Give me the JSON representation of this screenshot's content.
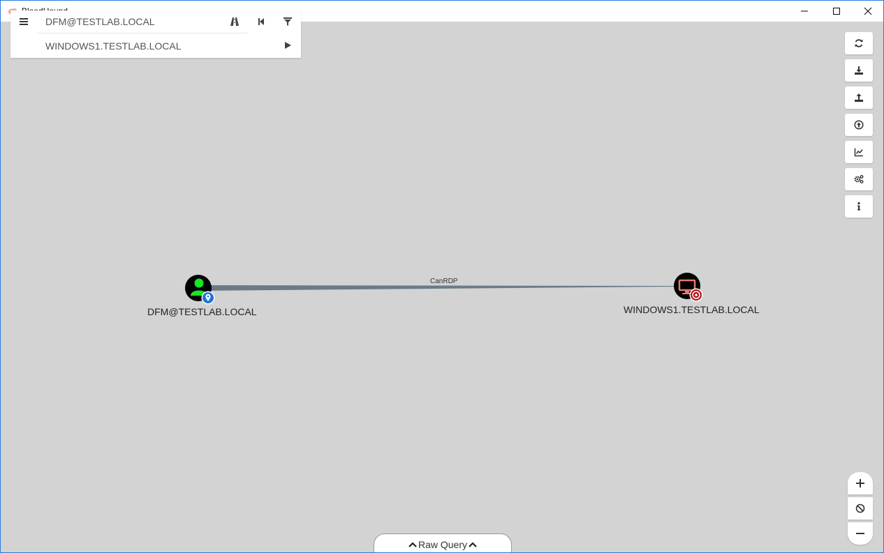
{
  "window": {
    "title": "BloodHound"
  },
  "search": {
    "start_node": "DFM@TESTLAB.LOCAL",
    "target_node": "WINDOWS1.TESTLAB.LOCAL"
  },
  "toolbar_icons": [
    "refresh-icon",
    "export-icon",
    "import-icon",
    "upload-data-icon",
    "database-info-icon",
    "settings-icon",
    "about-icon"
  ],
  "graph": {
    "source": {
      "label": "DFM@TESTLAB.LOCAL",
      "type": "User",
      "badge": "start-marker",
      "color": "#17e625"
    },
    "target": {
      "label": "WINDOWS1.TESTLAB.LOCAL",
      "type": "Computer",
      "badge": "target-marker",
      "color": "#e67873"
    },
    "edge": {
      "label": "CanRDP",
      "color": "#6b7b85"
    }
  },
  "raw_query": {
    "label": "Raw Query"
  }
}
